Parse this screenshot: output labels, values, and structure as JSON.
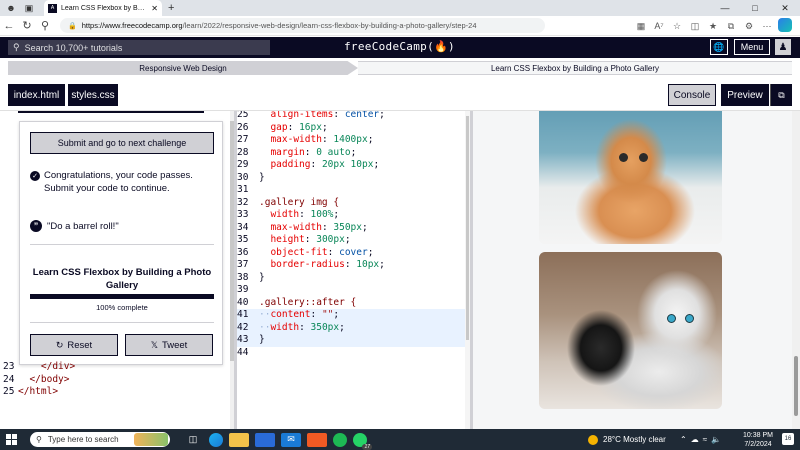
{
  "browser": {
    "tab_title": "Learn CSS Flexbox by Building a",
    "tab_favicon": "A",
    "url_host": "https://www.freecodecamp.org",
    "url_path": "/learn/2022/responsive-web-design/learn-css-flexbox-by-building-a-photo-gallery/step-24"
  },
  "fcc_nav": {
    "search_placeholder": "Search 10,700+ tutorials",
    "logo": "freeCodeCamp(🔥)",
    "menu_label": "Menu"
  },
  "breadcrumb": {
    "superblock": "Responsive Web Design",
    "block": "Learn CSS Flexbox by Building a Photo Gallery"
  },
  "editor_tabs": {
    "file1": "index.html",
    "file2": "styles.css",
    "console": "Console",
    "preview": "Preview"
  },
  "completion": {
    "submit_label": "Submit and go to next challenge",
    "pass_line1": "Congratulations, your code passes.",
    "pass_line2": "Submit your code to continue.",
    "quote": "\"Do a barrel roll!\"",
    "course_line1": "Learn CSS Flexbox by Building a Photo",
    "course_line2": "Gallery",
    "progress_percent": 100,
    "progress_text": "100% complete",
    "reset_label": "Reset",
    "tweet_label": "Tweet"
  },
  "left_code": [
    {
      "ln": "23",
      "code": "    </div>"
    },
    {
      "ln": "24",
      "code": "  </body>"
    },
    {
      "ln": "25",
      "code": "</html>"
    }
  ],
  "css_code": {
    "l25": {
      "ln": "25",
      "prop": "align-items",
      "value": "center"
    },
    "l26": {
      "ln": "26",
      "prop": "gap",
      "value": "16px"
    },
    "l27": {
      "ln": "27",
      "prop": "max-width",
      "value": "1400px"
    },
    "l28": {
      "ln": "28",
      "prop": "margin",
      "value": "0 auto"
    },
    "l29": {
      "ln": "29",
      "prop": "padding",
      "value": "20px 10px"
    },
    "l30": {
      "ln": "30",
      "text": "}"
    },
    "l31": {
      "ln": "31",
      "text": ""
    },
    "l32": {
      "ln": "32",
      "selector": ".gallery img {"
    },
    "l33": {
      "ln": "33",
      "prop": "width",
      "value": "100%"
    },
    "l34": {
      "ln": "34",
      "prop": "max-width",
      "value": "350px"
    },
    "l35": {
      "ln": "35",
      "prop": "height",
      "value": "300px"
    },
    "l36": {
      "ln": "36",
      "prop": "object-fit",
      "value": "cover"
    },
    "l37": {
      "ln": "37",
      "prop": "border-radius",
      "value": "10px"
    },
    "l38": {
      "ln": "38",
      "text": "}"
    },
    "l39": {
      "ln": "39",
      "text": ""
    },
    "l40": {
      "ln": "40",
      "selector": ".gallery::after {"
    },
    "l41": {
      "ln": "41",
      "prop": "content",
      "value": "\"\""
    },
    "l42": {
      "ln": "42",
      "prop": "width",
      "value": "350px"
    },
    "l43": {
      "ln": "43",
      "text": "}"
    },
    "l44": {
      "ln": "44",
      "text": ""
    }
  },
  "taskbar": {
    "search_placeholder": "Type here to search",
    "whatsapp_badge": "17",
    "weather_temp": "28°C",
    "weather_desc": "Mostly clear",
    "time": "10:38 PM",
    "date": "7/2/2024",
    "notifications": "16"
  },
  "colors": {
    "fcc_dark": "#0a0a23",
    "fcc_gray": "#d0d0d5",
    "css_prop": "#e50000",
    "css_value": "#098658",
    "css_keyword": "#0451a5",
    "css_selector": "#800000"
  }
}
